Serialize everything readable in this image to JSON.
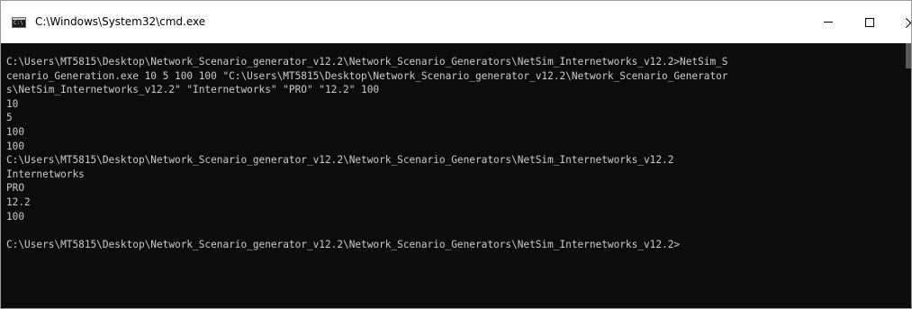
{
  "window": {
    "title": "C:\\Windows\\System32\\cmd.exe",
    "app_icon": "console-app-icon"
  },
  "caption_buttons": {
    "minimize": "minimize-icon",
    "maximize": "maximize-icon",
    "close": "close-icon"
  },
  "console": {
    "lines": [
      "C:\\Users\\MT5815\\Desktop\\Network_Scenario_generator_v12.2\\Network_Scenario_Generators\\NetSim_Internetworks_v12.2>NetSim_S",
      "cenario_Generation.exe 10 5 100 100 \"C:\\Users\\MT5815\\Desktop\\Network_Scenario_generator_v12.2\\Network_Scenario_Generator",
      "s\\NetSim_Internetworks_v12.2\" \"Internetworks\" \"PRO\" \"12.2\" 100",
      "10",
      "5",
      "100",
      "100",
      "C:\\Users\\MT5815\\Desktop\\Network_Scenario_generator_v12.2\\Network_Scenario_Generators\\NetSim_Internetworks_v12.2",
      "Internetworks",
      "PRO",
      "12.2",
      "100",
      "",
      "C:\\Users\\MT5815\\Desktop\\Network_Scenario_generator_v12.2\\Network_Scenario_Generators\\NetSim_Internetworks_v12.2>"
    ]
  },
  "colors": {
    "console_background": "#0c0c0c",
    "console_text": "#cccccc",
    "titlebar_background": "#ffffff"
  }
}
